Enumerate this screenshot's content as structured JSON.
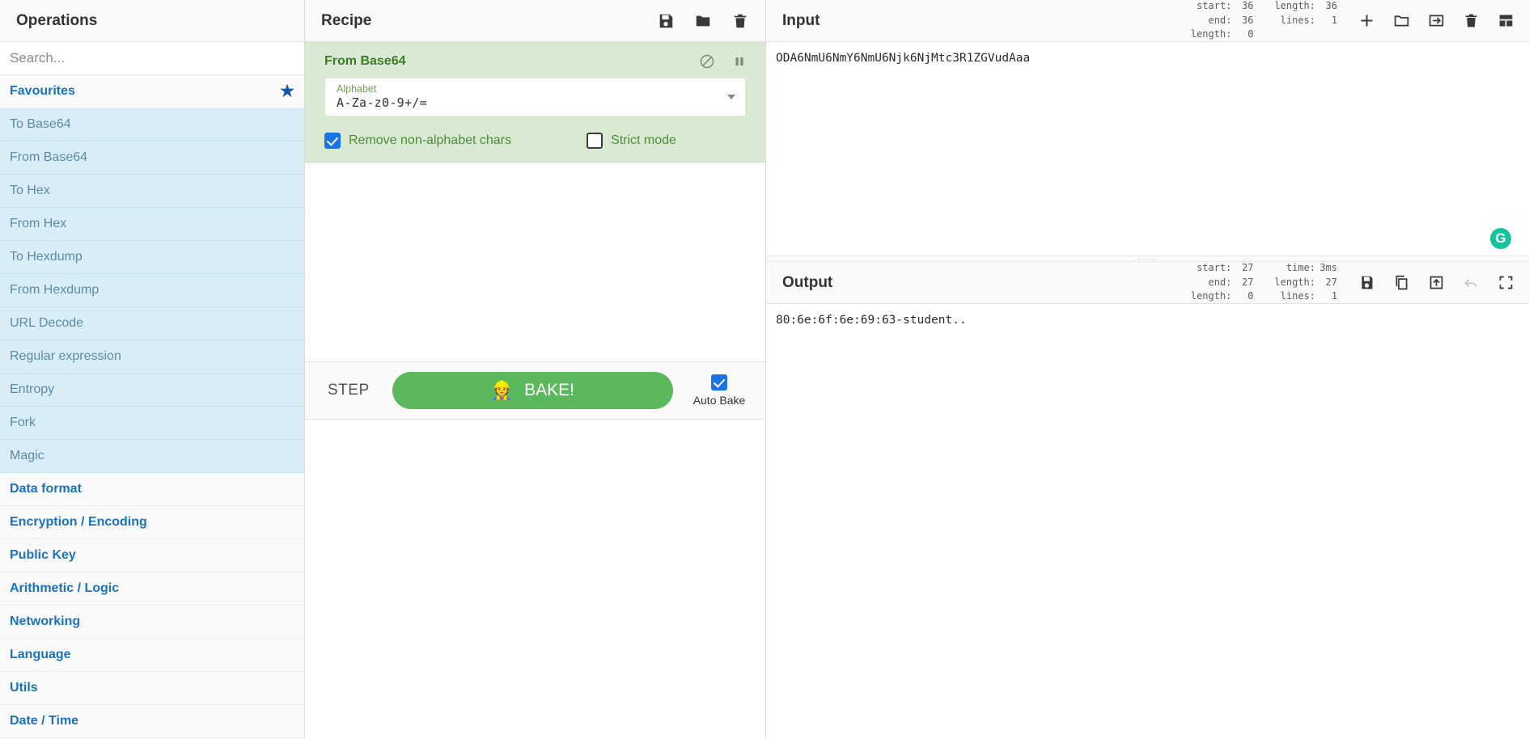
{
  "operations": {
    "title": "Operations",
    "search": {
      "placeholder": "Search...",
      "value": ""
    },
    "favourites": {
      "label": "Favourites",
      "star_icon": "star-icon"
    },
    "favourite_items": [
      "To Base64",
      "From Base64",
      "To Hex",
      "From Hex",
      "To Hexdump",
      "From Hexdump",
      "URL Decode",
      "Regular expression",
      "Entropy",
      "Fork",
      "Magic"
    ],
    "categories": [
      "Data format",
      "Encryption / Encoding",
      "Public Key",
      "Arithmetic / Logic",
      "Networking",
      "Language",
      "Utils",
      "Date / Time"
    ]
  },
  "recipe": {
    "title": "Recipe",
    "header_icons": [
      "save-icon",
      "folder-icon",
      "trash-icon"
    ],
    "operation": {
      "name": "From Base64",
      "control_icons": [
        "disable-icon",
        "breakpoint-icon"
      ],
      "arg": {
        "label": "Alphabet",
        "value": "A-Za-z0-9+/=",
        "caret_icon": "chevron-down-icon"
      },
      "checkboxes": [
        {
          "label": "Remove non-alphabet chars",
          "checked": true
        },
        {
          "label": "Strict mode",
          "checked": false
        }
      ]
    },
    "controls": {
      "step_label": "STEP",
      "bake_label": "BAKE!",
      "bake_icon": "chef-icon",
      "bake_color": "#5cb85c",
      "auto_bake_label": "Auto Bake",
      "auto_bake_checked": true
    }
  },
  "input": {
    "title": "Input",
    "stats": {
      "col1": [
        {
          "key": "start:",
          "value": "36"
        },
        {
          "key": "end:",
          "value": "36"
        },
        {
          "key": "length:",
          "value": "0"
        }
      ],
      "col2": [
        {
          "key": "length:",
          "value": "36"
        },
        {
          "key": "lines:",
          "value": "1"
        }
      ]
    },
    "icons": [
      "plus-icon",
      "folder-icon",
      "open-folder-as-input-icon",
      "trash-icon",
      "tabs-icon"
    ],
    "text": "ODA6NmU6NmY6NmU6Njk6NjMtc3R1ZGVudAaa"
  },
  "output": {
    "title": "Output",
    "stats": {
      "col1": [
        {
          "key": "start:",
          "value": "27"
        },
        {
          "key": "end:",
          "value": "27"
        },
        {
          "key": "length:",
          "value": "0"
        }
      ],
      "col2": [
        {
          "key": "time:",
          "value": "3ms"
        },
        {
          "key": "length:",
          "value": "27"
        },
        {
          "key": "lines:",
          "value": "1"
        }
      ]
    },
    "icons": [
      "save-icon",
      "copy-icon",
      "replace-input-icon",
      "undo-icon",
      "maximise-icon"
    ],
    "text": "80:6e:6f:6e:69:63-student.."
  },
  "overlay": {
    "grammarly_badge": "G",
    "grammarly_color": "#15c39a"
  }
}
